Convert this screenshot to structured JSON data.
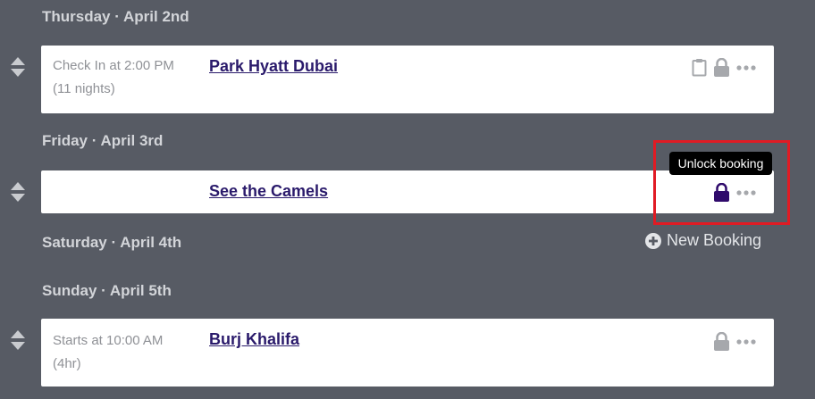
{
  "days": [
    {
      "label": "Thursday · April 2nd"
    },
    {
      "label": "Friday · April 3rd"
    },
    {
      "label": "Saturday · April 4th"
    },
    {
      "label": "Sunday · April 5th"
    }
  ],
  "bookings": [
    {
      "meta_line1": "Check In at 2:00 PM",
      "meta_line2": "(11 nights)",
      "title": "Park Hyatt Dubai"
    },
    {
      "title": "See the Camels"
    },
    {
      "meta_line1": "Starts at 10:00 AM",
      "meta_line2": "(4hr)",
      "title": "Burj Khalifa"
    }
  ],
  "tooltip": {
    "text": "Unlock booking"
  },
  "new_booking": {
    "label": "New Booking"
  },
  "icons": {
    "drag": "drag-handle-icon",
    "clipboard": "clipboard-icon",
    "lock": "lock-icon",
    "more": "more-icon",
    "plus": "plus-circle-icon"
  },
  "colors": {
    "background": "#575b64",
    "title_link": "#2a1a6b",
    "active_lock": "#2f0a6b",
    "inactive_icon": "#a6a8ac",
    "highlight": "#e01b24"
  }
}
